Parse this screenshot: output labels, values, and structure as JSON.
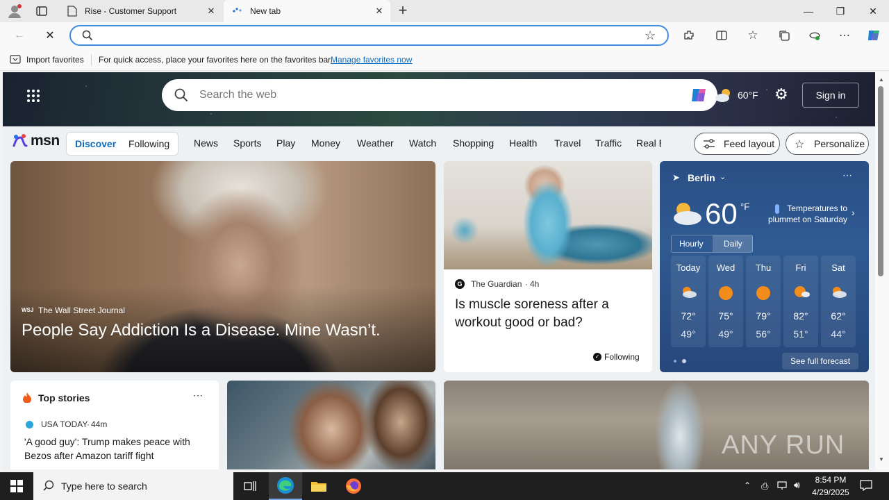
{
  "browser": {
    "tabs": [
      {
        "title": "Rise - Customer Support",
        "active": false
      },
      {
        "title": "New tab",
        "active": true
      }
    ],
    "address": {
      "value": "",
      "placeholder": ""
    },
    "favorites_bar": {
      "import_label": "Import favorites",
      "hint": "For quick access, place your favorites here on the favorites bar.",
      "manage_link": "Manage favorites now"
    }
  },
  "msn": {
    "search_placeholder": "Search the web",
    "header_temp": "60°F",
    "sign_in": "Sign in",
    "logo": "msn",
    "feed_tabs": [
      "Discover",
      "Following"
    ],
    "categories": [
      "News",
      "Sports",
      "Play",
      "Money",
      "Weather",
      "Watch",
      "Shopping",
      "Health",
      "Travel",
      "Traffic",
      "Real E"
    ],
    "feed_layout": "Feed layout",
    "personalize": "Personalize",
    "hero": {
      "source": "The Wall Street Journal",
      "source_logo": "WSJ",
      "headline": "People Say Addiction Is a Disease. Mine Wasn’t."
    },
    "article": {
      "source": "The Guardian",
      "age": "4h",
      "headline": "Is muscle soreness after a workout good or bad?",
      "following": "Following"
    },
    "weather": {
      "city": "Berlin",
      "temp": "60",
      "unit": "°F",
      "alert": "Temperatures to plummet on Saturday",
      "toggle": [
        "Hourly",
        "Daily"
      ],
      "days": [
        {
          "name": "Today",
          "hi": "72°",
          "lo": "49°",
          "icon": "partly-cloudy-icon"
        },
        {
          "name": "Wed",
          "hi": "75°",
          "lo": "49°",
          "icon": "sun-icon"
        },
        {
          "name": "Thu",
          "hi": "79°",
          "lo": "56°",
          "icon": "sun-icon"
        },
        {
          "name": "Fri",
          "hi": "82°",
          "lo": "51°",
          "icon": "sun-cloud-icon"
        },
        {
          "name": "Sat",
          "hi": "62°",
          "lo": "44°",
          "icon": "partly-cloudy-icon"
        }
      ],
      "see_full": "See full forecast"
    },
    "top_stories": {
      "title": "Top stories",
      "source": "USA TODAY",
      "age": "44m",
      "headline": "'A good guy': Trump makes peace with Bezos after Amazon tariff fight"
    },
    "watermark": "ANY RUN"
  },
  "taskbar": {
    "search_placeholder": "Type here to search",
    "time": "8:54 PM",
    "date": "4/29/2025"
  }
}
